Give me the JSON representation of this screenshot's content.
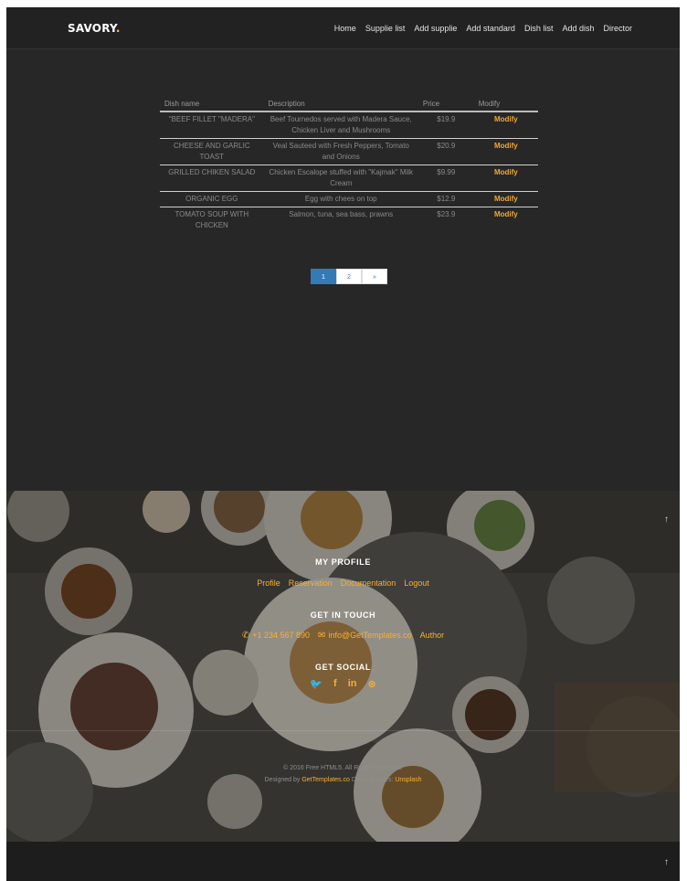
{
  "brand": {
    "name": "SAVORY",
    "dot": "."
  },
  "nav": [
    "Home",
    "Supplie list",
    "Add supplie",
    "Add standard",
    "Dish list",
    "Add dish",
    "Director"
  ],
  "table": {
    "headers": [
      "Dish name",
      "Description",
      "Price",
      "Modify"
    ],
    "rows": [
      {
        "name": "\"BEEF FILLET \"MADERA\"",
        "description": "Beef Tournedos served with Madera Sauce, Chicken Liver and Mushrooms",
        "price": "$19.9",
        "modify": "Modify"
      },
      {
        "name": "CHEESE AND GARLIC TOAST",
        "description": "Veal Sauteed with Fresh Peppers, Tomato and Onions",
        "price": "$20.9",
        "modify": "Modify"
      },
      {
        "name": "GRILLED CHIKEN SALAD",
        "description": "Chicken Escalope stuffed with \"Kajmak\" Milk Cream",
        "price": "$9.99",
        "modify": "Modify"
      },
      {
        "name": "ORGANIC EGG",
        "description": "Egg with chees on top",
        "price": "$12.9",
        "modify": "Modify"
      },
      {
        "name": "TOMATO SOUP WITH CHICKEN",
        "description": "Salmon, tuna, sea bass, prawns",
        "price": "$23.9",
        "modify": "Modify"
      }
    ]
  },
  "pagination": {
    "pages": [
      "1",
      "2"
    ],
    "next": "»",
    "current": "1"
  },
  "footer": {
    "profile_title": "MY PROFILE",
    "profile_links": [
      "Profile",
      "Reservation",
      "Documentation",
      "Logout"
    ],
    "touch_title": "GET IN TOUCH",
    "phone": "+1 234 567 890",
    "email": "info@GetTemplates.co",
    "author": "Author",
    "social_title": "GET SOCIAL",
    "social_icons": [
      "twitter-icon",
      "facebook-icon",
      "linkedin-icon",
      "dribbble-icon"
    ],
    "copyright": "© 2016 Free HTML5. All Rights Reserved.",
    "designed_by_prefix": "Designed by",
    "designed_by_link": "GetTemplates.co",
    "demo_images_label": "Demo Images:",
    "demo_images_link": "Unsplash"
  },
  "colors": {
    "accent": "#f7b032",
    "modify": "#f0a83a",
    "pagination_active": "#337ab7",
    "background": "#272727"
  }
}
